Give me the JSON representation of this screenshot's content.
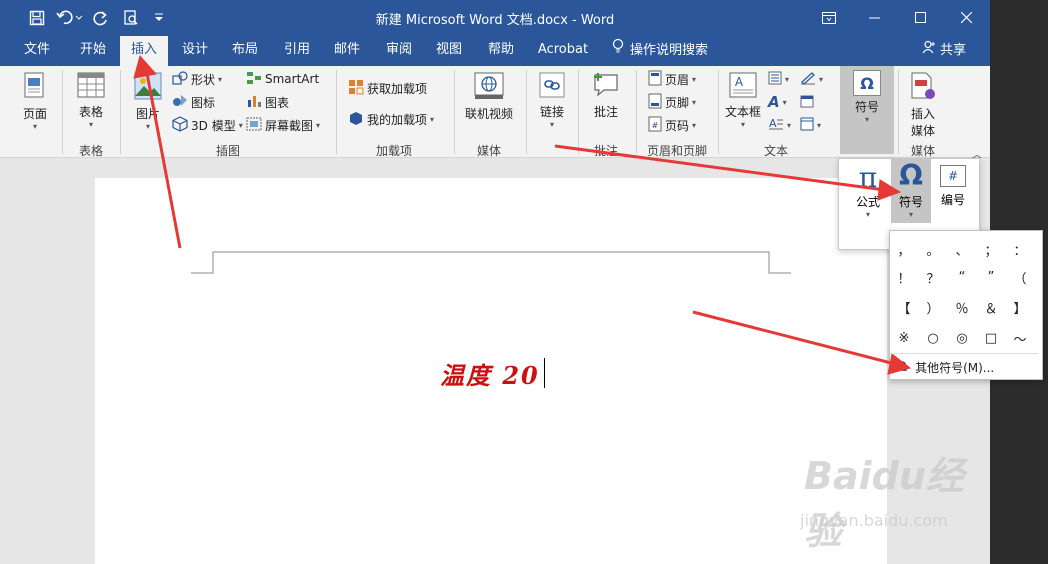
{
  "window": {
    "title": "新建 Microsoft Word 文档.docx  -  Word",
    "colors": {
      "brand": "#2b579a",
      "arrow": "#e53935",
      "doc_text": "#cc1111"
    }
  },
  "tabs": [
    {
      "label": "文件"
    },
    {
      "label": "开始"
    },
    {
      "label": "插入"
    },
    {
      "label": "设计"
    },
    {
      "label": "布局"
    },
    {
      "label": "引用"
    },
    {
      "label": "邮件"
    },
    {
      "label": "审阅"
    },
    {
      "label": "视图"
    },
    {
      "label": "帮助"
    },
    {
      "label": "Acrobat"
    }
  ],
  "active_tab": "插入",
  "tell_me": "操作说明搜索",
  "share": "共享",
  "ribbon": {
    "pages": {
      "label": "页面"
    },
    "table": {
      "label": "表格",
      "group": "表格"
    },
    "picture": {
      "label": "图片"
    },
    "shapes": "形状",
    "icons": "图标",
    "model3d": "3D 模型",
    "smartart": "SmartArt",
    "chart": "图表",
    "screenshot": "屏幕截图",
    "illustrations_group": "插图",
    "get_addins": "获取加载项",
    "my_addins": "我的加载项",
    "addins_group": "加载项",
    "online_video": "联机视频",
    "media_group": "媒体",
    "link": "链接",
    "comment": "批注",
    "comment_group": "批注",
    "header": "页眉",
    "footer": "页脚",
    "page_number": "页码",
    "header_footer_group": "页眉和页脚",
    "textbox": "文本框",
    "text_group": "文本",
    "symbols": "符号",
    "insert_media": {
      "line1": "插入",
      "line2": "媒体"
    },
    "media_group2": "媒体"
  },
  "symbol_popup": {
    "equation": "公式",
    "symbol": "符号",
    "number": "编号"
  },
  "symbol_grid": {
    "rows": [
      [
        "，",
        "。",
        "、",
        "；",
        "："
      ],
      [
        "！",
        "？",
        "“",
        "”",
        "（"
      ],
      [
        "【",
        "）",
        "％",
        "＆",
        "】"
      ],
      [
        "※",
        "○",
        "◎",
        "□",
        "～"
      ]
    ],
    "more": "其他符号(M)..."
  },
  "document": {
    "text": "温度 20"
  },
  "watermark": {
    "brand": "Baidu经验",
    "url": "jingyan.baidu.com"
  }
}
